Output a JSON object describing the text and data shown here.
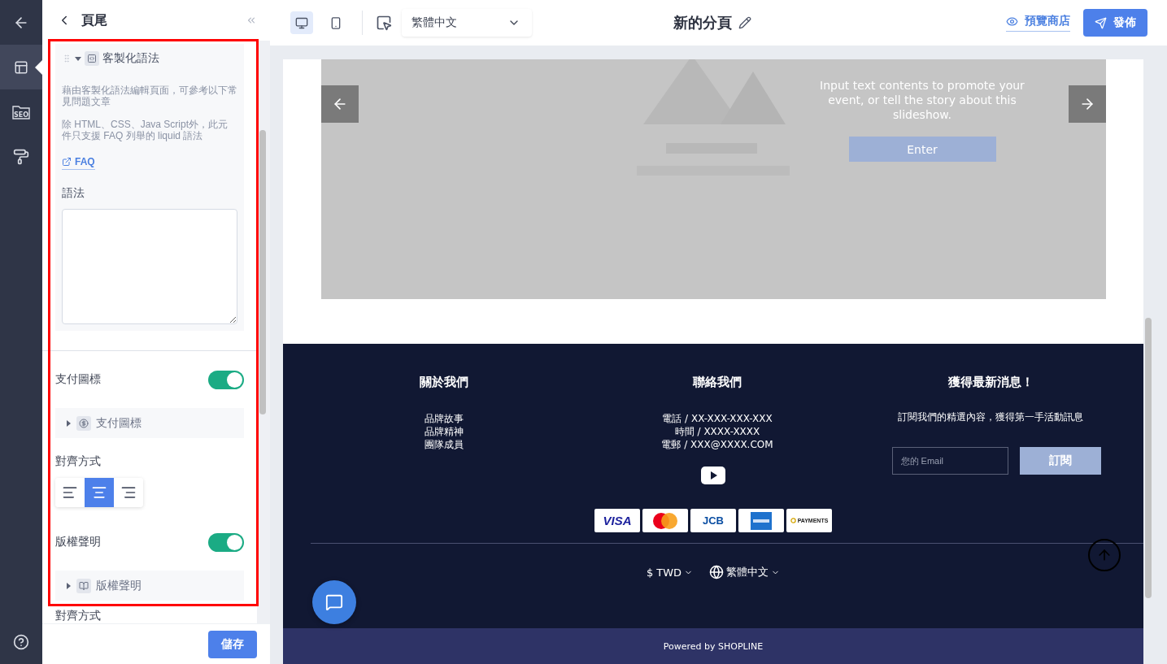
{
  "rail": {
    "items": [
      {
        "kind": "layout",
        "selected": true
      },
      {
        "kind": "seo",
        "label": "SEO",
        "selected": false
      },
      {
        "kind": "theme",
        "selected": false
      }
    ]
  },
  "panel": {
    "title": "頁尾",
    "section": {
      "title": "客製化語法",
      "expanded": true,
      "paragraphs": [
        "藉由客製化語法編輯頁面，可參考以下常見問題文章",
        "除 HTML、CSS、Java Script外，此元件只支援 FAQ 列舉的 liquid 語法"
      ],
      "link": "FAQ",
      "field_label": "語法"
    },
    "settings": [
      {
        "kind": "toggle",
        "label": "支付圖標",
        "on": true
      },
      {
        "kind": "group",
        "label": "支付圖標",
        "expanded": false
      },
      {
        "kind": "align",
        "label": "對齊方式",
        "options": [
          {
            "kind": "left",
            "selected": false
          },
          {
            "kind": "center",
            "selected": true
          },
          {
            "kind": "right",
            "selected": false
          }
        ]
      },
      {
        "kind": "toggle",
        "label": "版權聲明",
        "on": true
      },
      {
        "kind": "group",
        "label": "版權聲明",
        "expanded": false
      },
      {
        "kind": "heading",
        "label": "對齊方式"
      }
    ],
    "save": "儲存"
  },
  "toolbar": {
    "devices": [
      {
        "kind": "desktop",
        "selected": true
      },
      {
        "kind": "mobile",
        "selected": false
      }
    ],
    "language": "繁體中文",
    "page_title": "新的分頁",
    "preview": "預覽商店",
    "publish": "發佈"
  },
  "preview": {
    "slide": {
      "text": "Input text contents to promote your event, or tell the story about this slideshow.",
      "button": "Enter"
    },
    "footer": {
      "columns": [
        {
          "kind": "links",
          "title": "關於我們",
          "lines": [
            "品牌故事",
            "品牌精神",
            "團隊成員"
          ]
        },
        {
          "kind": "contact",
          "title": "聯絡我們",
          "lines": [
            "電話 / XX-XXX-XXX-XXX",
            "時間 / XXXX-XXXX",
            "電郵 / XXX@XXXX.COM"
          ]
        },
        {
          "kind": "newsletter",
          "title": "獲得最新消息！",
          "text": "訂閱我們的精選內容，獲得第一手活動訊息",
          "placeholder": "您的 Email",
          "button": "訂閱"
        }
      ],
      "payments": [
        {
          "kind": "visa",
          "label": "VISA"
        },
        {
          "kind": "mastercard"
        },
        {
          "kind": "jcb",
          "label": "JCB"
        },
        {
          "kind": "amex"
        },
        {
          "kind": "payments",
          "label": "PAYMENTS"
        }
      ],
      "currency": "$ TWD",
      "language": "繁體中文",
      "powered": "Powered by SHOPLINE"
    }
  }
}
